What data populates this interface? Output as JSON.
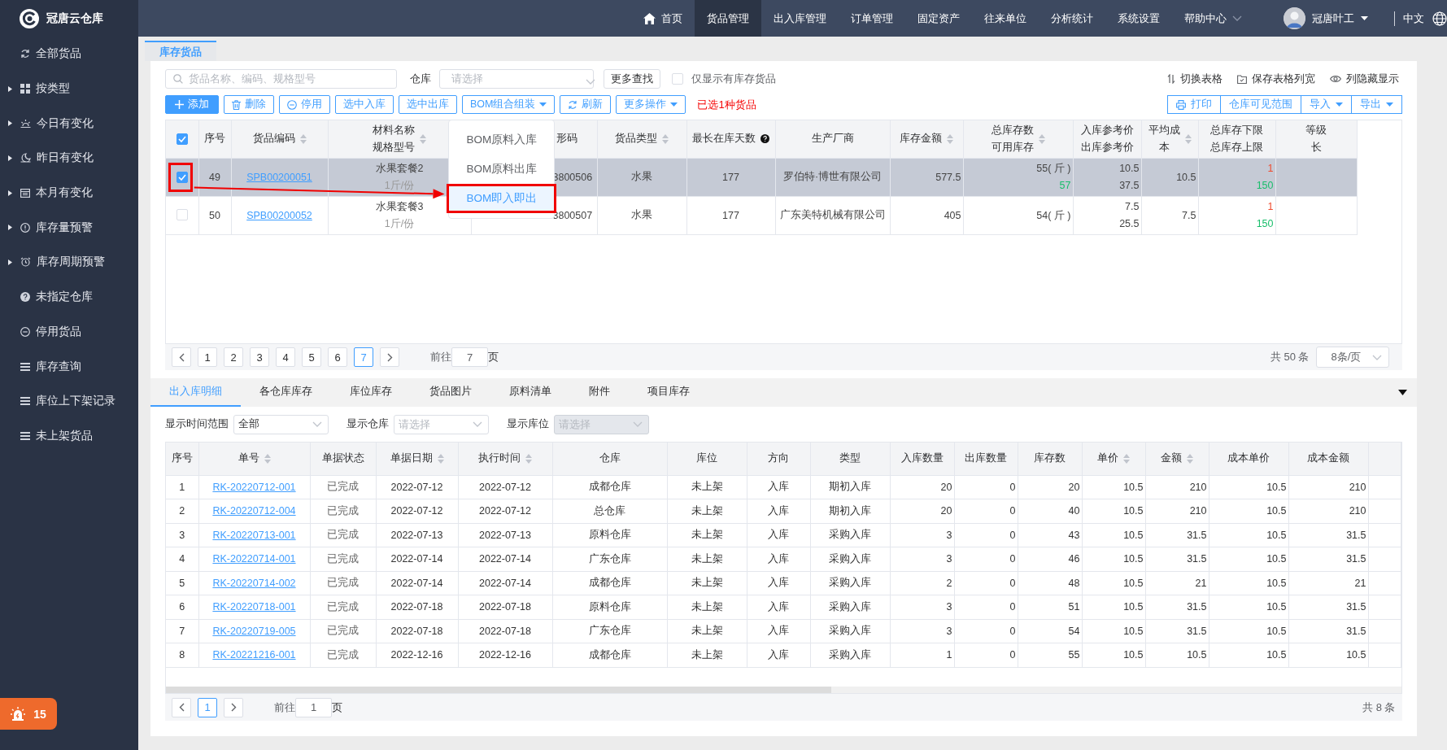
{
  "app": {
    "name": "冠唐云仓库"
  },
  "sidebar": {
    "items": [
      {
        "label": "全部货品"
      },
      {
        "label": "按类型",
        "expanded": false
      },
      {
        "label": "今日有变化",
        "expanded": false
      },
      {
        "label": "昨日有变化",
        "expanded": false
      },
      {
        "label": "本月有变化",
        "expanded": false
      },
      {
        "label": "库存量预警",
        "expanded": false
      },
      {
        "label": "库存周期预警",
        "expanded": false
      },
      {
        "label": "未指定仓库"
      },
      {
        "label": "停用货品"
      },
      {
        "label": "库存查询"
      },
      {
        "label": "库位上下架记录"
      },
      {
        "label": "未上架货品"
      }
    ],
    "alarm": {
      "count": "15"
    }
  },
  "topbar": {
    "nav": [
      {
        "label": "首页",
        "selected": false
      },
      {
        "label": "货品管理",
        "selected": true
      },
      {
        "label": "出入库管理",
        "selected": false
      },
      {
        "label": "订单管理",
        "selected": false
      },
      {
        "label": "固定资产",
        "selected": false
      },
      {
        "label": "往来单位",
        "selected": false
      },
      {
        "label": "分析统计",
        "selected": false
      },
      {
        "label": "系统设置",
        "selected": false
      },
      {
        "label": "帮助中心",
        "selected": false
      }
    ],
    "user": "冠唐叶工",
    "language": "中文"
  },
  "page_tabs": [
    {
      "label": "库存货品",
      "selected": true
    }
  ],
  "goods": {
    "search": {
      "placeholder": "货品名称、编码、规格型号"
    },
    "warehouse": {
      "label": "仓库",
      "placeholder": "请选择"
    },
    "more_search": "更多查找",
    "stock_only": {
      "label": "仅显示有库存货品",
      "checked": false
    },
    "links": [
      "切换表格",
      "保存表格列宽",
      "列隐藏显示"
    ],
    "buttons": [
      {
        "label": "添加",
        "kind": "primary"
      },
      {
        "label": "删除",
        "kind": "plain"
      },
      {
        "label": "停用",
        "kind": "plain"
      },
      {
        "label": "选中入库",
        "kind": "plain"
      },
      {
        "label": "选中出库",
        "kind": "plain"
      },
      {
        "label": "BOM组合组装",
        "kind": "dropdown",
        "menu": [
          {
            "label": "BOM原料入库",
            "selected": false,
            "highlighted": false
          },
          {
            "label": "BOM原料出库",
            "selected": false,
            "highlighted": false
          },
          {
            "label": "BOM即入即出",
            "selected": true,
            "highlighted": true
          }
        ]
      },
      {
        "label": "刷新",
        "kind": "plain"
      },
      {
        "label": "更多操作",
        "kind": "dropdown"
      }
    ],
    "selection_note": "已选1种货品",
    "right_buttons": [
      {
        "label": "打印",
        "kind": "plain"
      },
      {
        "label": "仓库可见范围",
        "kind": "plain"
      },
      {
        "label": "导入",
        "kind": "dropdown"
      },
      {
        "label": "导出",
        "kind": "dropdown"
      }
    ],
    "table": {
      "all_checked": true,
      "columns": [
        {
          "label": "序号",
          "sortable": false
        },
        {
          "label": "货品编码",
          "sortable": true
        },
        {
          "label": "材料名称",
          "sublabel": "规格型号",
          "sortable": true
        },
        {
          "label": "形码",
          "sortable": false
        },
        {
          "label": "货品类型",
          "sortable": true
        },
        {
          "label": "最长在库天数",
          "sortable": false
        },
        {
          "label": "生产厂商",
          "sortable": false
        },
        {
          "label": "库存金额",
          "sortable": true
        },
        {
          "label": "总库存数",
          "sublabel": "可用库存",
          "sortable": true
        },
        {
          "label": "入库参考价",
          "sublabel": "出库参考价",
          "sortable": false
        },
        {
          "label": "平均成",
          "sublabel": "本",
          "sortable": true
        },
        {
          "label": "总库存下限",
          "sublabel": "总库存上限",
          "sortable": false
        },
        {
          "label": "等级",
          "sublabel": "长",
          "sortable": false
        }
      ],
      "rows": [
        {
          "selected": true,
          "highlighted": true,
          "index": "49",
          "code": "SPB00200051",
          "name": "水果套餐2",
          "spec": "1斤/份",
          "barcode": "3800506",
          "type": "水果",
          "days": "177",
          "maker": "罗伯特·博世有限公司",
          "amount": "577.5",
          "stock": "55( 斤 )",
          "available": "57",
          "in_price": "10.5",
          "out_price": "37.5",
          "avg_cost": "10.5",
          "min": "1",
          "max": "150"
        },
        {
          "selected": false,
          "highlighted": false,
          "index": "50",
          "code": "SPB00200052",
          "name": "水果套餐3",
          "spec": "1斤/份",
          "barcode": "3800507",
          "type": "水果",
          "days": "177",
          "maker": "广东美特机械有限公司",
          "amount": "405",
          "stock": "54( 斤 )",
          "in_price": "7.5",
          "out_price": "25.5",
          "avg_cost": "7.5",
          "min": "1",
          "max": "150"
        }
      ]
    },
    "pagination": {
      "pages": [
        {
          "label": "1",
          "selected": false
        },
        {
          "label": "2",
          "selected": false
        },
        {
          "label": "3",
          "selected": false
        },
        {
          "label": "4",
          "selected": false
        },
        {
          "label": "5",
          "selected": false
        },
        {
          "label": "6",
          "selected": false
        },
        {
          "label": "7",
          "selected": true
        }
      ],
      "goto_label": "前往",
      "goto_value": "7",
      "page_unit": "页",
      "total": "共 50 条",
      "page_size": "8条/页"
    }
  },
  "detail": {
    "tabs": [
      {
        "label": "出入库明细",
        "selected": true
      },
      {
        "label": "各仓库库存",
        "selected": false
      },
      {
        "label": "库位库存",
        "selected": false
      },
      {
        "label": "货品图片",
        "selected": false
      },
      {
        "label": "原料清单",
        "selected": false
      },
      {
        "label": "附件",
        "selected": false
      },
      {
        "label": "项目库存",
        "selected": false
      }
    ],
    "filters": [
      {
        "label": "显示时间范围",
        "value": "全部",
        "disabled": false
      },
      {
        "label": "显示仓库",
        "placeholder": "请选择",
        "disabled": false
      },
      {
        "label": "显示库位",
        "placeholder": "请选择",
        "disabled": true
      }
    ],
    "table": {
      "columns": [
        {
          "label": "序号",
          "kind": "text",
          "sortable": false
        },
        {
          "label": "单号",
          "kind": "link",
          "sortable": true
        },
        {
          "label": "单据状态",
          "kind": "status",
          "sortable": false
        },
        {
          "label": "单据日期",
          "kind": "text",
          "sortable": true
        },
        {
          "label": "执行时间",
          "kind": "text",
          "sortable": true
        },
        {
          "label": "仓库",
          "kind": "text",
          "sortable": false
        },
        {
          "label": "库位",
          "kind": "text",
          "sortable": false
        },
        {
          "label": "方向",
          "kind": "text",
          "sortable": false
        },
        {
          "label": "类型",
          "kind": "text",
          "sortable": false
        },
        {
          "label": "入库数量",
          "kind": "number",
          "sortable": false
        },
        {
          "label": "出库数量",
          "kind": "number",
          "sortable": false
        },
        {
          "label": "库存数",
          "kind": "number",
          "sortable": false
        },
        {
          "label": "单价",
          "kind": "number",
          "sortable": true
        },
        {
          "label": "金额",
          "kind": "number",
          "sortable": true
        },
        {
          "label": "成本单价",
          "kind": "number",
          "sortable": false
        },
        {
          "label": "成本金额",
          "kind": "number",
          "sortable": false
        }
      ],
      "rows": [
        [
          "1",
          "RK-20220712-001",
          "已完成",
          "2022-07-12",
          "2022-07-12",
          "成都仓库",
          "未上架",
          "入库",
          "期初入库",
          "20",
          "0",
          "20",
          "10.5",
          "210",
          "10.5",
          "210"
        ],
        [
          "2",
          "RK-20220712-004",
          "已完成",
          "2022-07-12",
          "2022-07-12",
          "总仓库",
          "未上架",
          "入库",
          "期初入库",
          "20",
          "0",
          "40",
          "10.5",
          "210",
          "10.5",
          "210"
        ],
        [
          "3",
          "RK-20220713-001",
          "已完成",
          "2022-07-13",
          "2022-07-13",
          "原料仓库",
          "未上架",
          "入库",
          "采购入库",
          "3",
          "0",
          "43",
          "10.5",
          "31.5",
          "10.5",
          "31.5"
        ],
        [
          "4",
          "RK-20220714-001",
          "已完成",
          "2022-07-14",
          "2022-07-14",
          "广东仓库",
          "未上架",
          "入库",
          "采购入库",
          "3",
          "0",
          "46",
          "10.5",
          "31.5",
          "10.5",
          "31.5"
        ],
        [
          "5",
          "RK-20220714-002",
          "已完成",
          "2022-07-14",
          "2022-07-14",
          "成都仓库",
          "未上架",
          "入库",
          "采购入库",
          "2",
          "0",
          "48",
          "10.5",
          "21",
          "10.5",
          "21"
        ],
        [
          "6",
          "RK-20220718-001",
          "已完成",
          "2022-07-18",
          "2022-07-18",
          "原料仓库",
          "未上架",
          "入库",
          "采购入库",
          "3",
          "0",
          "51",
          "10.5",
          "31.5",
          "10.5",
          "31.5"
        ],
        [
          "7",
          "RK-20220719-005",
          "已完成",
          "2022-07-18",
          "2022-07-18",
          "广东仓库",
          "未上架",
          "入库",
          "采购入库",
          "3",
          "0",
          "54",
          "10.5",
          "31.5",
          "10.5",
          "31.5"
        ],
        [
          "8",
          "RK-20221216-001",
          "已完成",
          "2022-12-16",
          "2022-12-16",
          "成都仓库",
          "未上架",
          "入库",
          "采购入库",
          "1",
          "0",
          "55",
          "10.5",
          "10.5",
          "10.5",
          "10.5"
        ]
      ]
    },
    "pagination": {
      "pages": [
        {
          "label": "1",
          "selected": true
        }
      ],
      "goto_label": "前往",
      "goto_value": "1",
      "page_unit": "页",
      "total": "共 8 条"
    }
  }
}
